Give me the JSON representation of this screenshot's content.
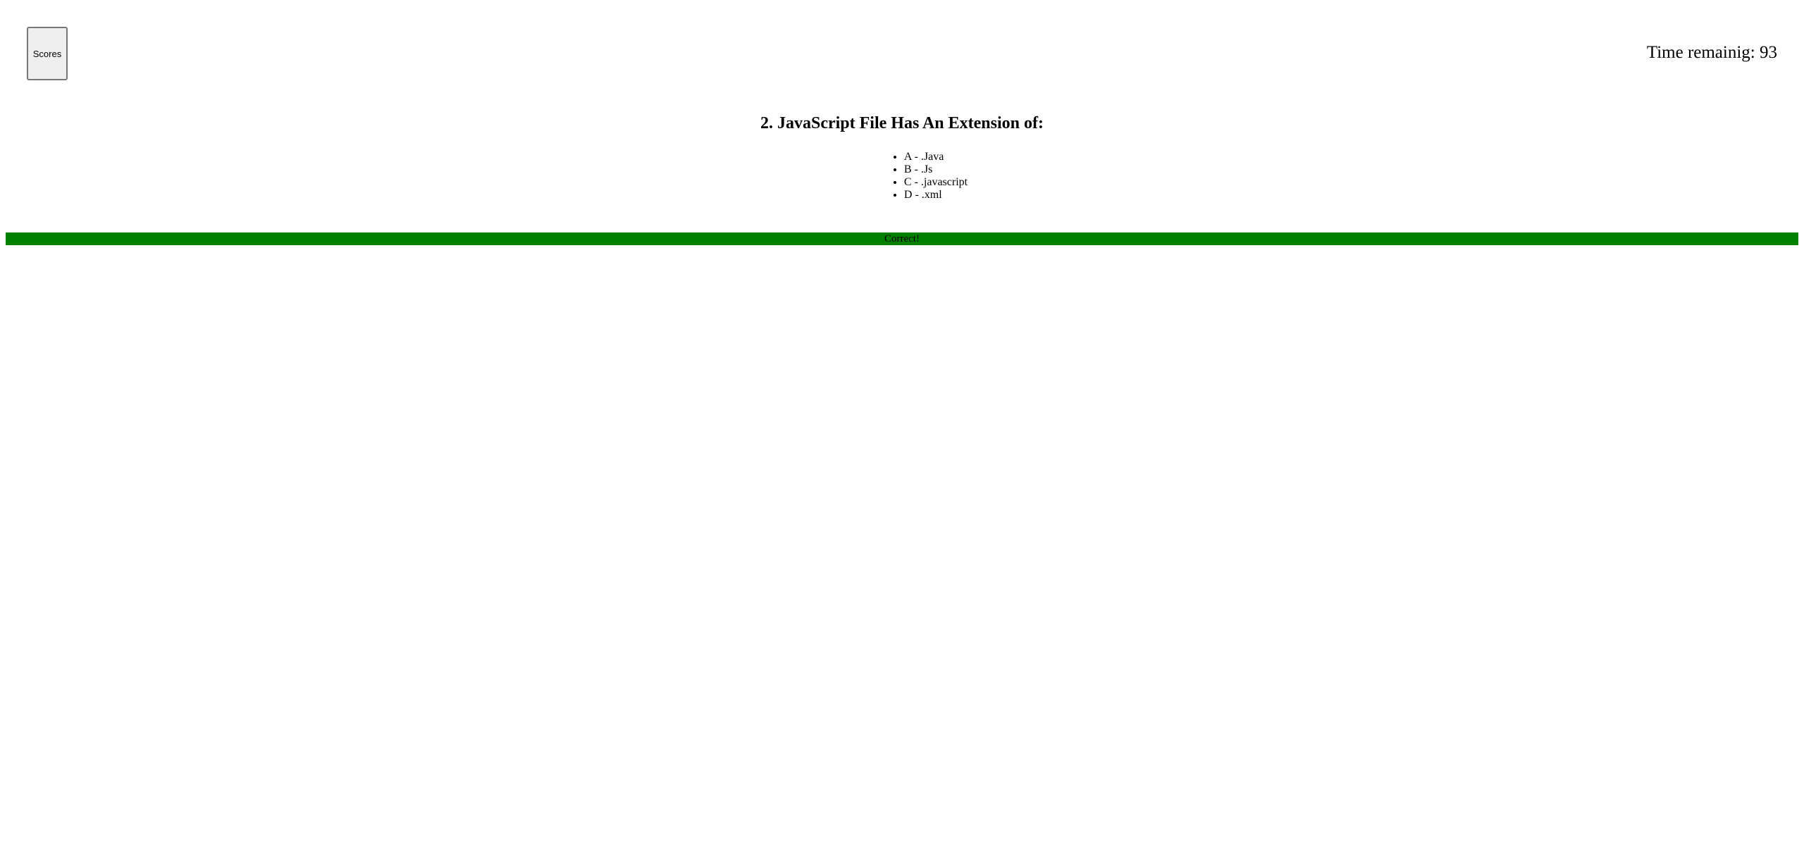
{
  "header": {
    "scores_label": "Scores",
    "timer_text": "Time remainig: 93"
  },
  "question": {
    "title": "2. JavaScript File Has An Extension of:",
    "choices": [
      {
        "label": "A - .Java"
      },
      {
        "label": "B - .Js"
      },
      {
        "label": "C - .javascript"
      },
      {
        "label": "D - .xml"
      }
    ]
  },
  "feedback": {
    "text": "Correct!",
    "color": "#008000"
  }
}
